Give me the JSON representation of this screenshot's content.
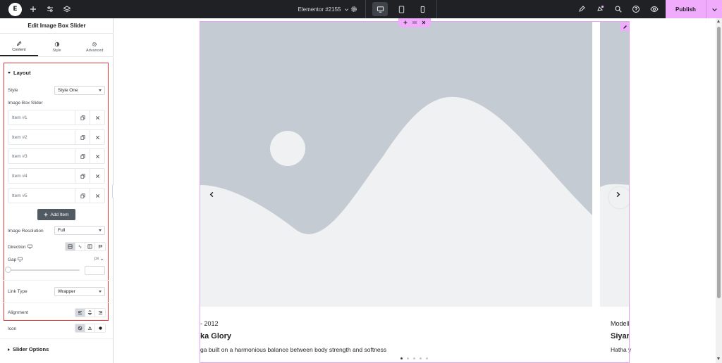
{
  "topbar": {
    "logo_letter": "E",
    "document_title": "Elementor #2155",
    "publish_label": "Publish",
    "icons": [
      "plus-icon",
      "sliders-icon",
      "layers-icon",
      "gear-icon",
      "desktop-icon",
      "tablet-icon",
      "mobile-icon",
      "notes-icon",
      "whats-new-icon",
      "search-icon",
      "help-icon",
      "preview-icon",
      "chevron-down-icon"
    ],
    "accent_color": "#f0abfc"
  },
  "panel": {
    "title": "Edit Image Box Slider",
    "tabs": [
      {
        "label": "Content",
        "icon": "pencil-icon",
        "active": true
      },
      {
        "label": "Style",
        "icon": "half-circle-icon",
        "active": false
      },
      {
        "label": "Advanced",
        "icon": "gear-icon",
        "active": false
      }
    ],
    "layout": {
      "heading": "Layout",
      "style_label": "Style",
      "style_value": "Style One",
      "repeater_label": "Image Box Slider",
      "items": [
        "Item #1",
        "Item #2",
        "Item #3",
        "Item #4",
        "Item #5"
      ],
      "add_item_label": "Add Item",
      "resolution_label": "Image Resolution",
      "resolution_value": "Full",
      "direction_label": "Direction",
      "gap_label": "Gap",
      "gap_unit": "px",
      "link_type_label": "Link Type",
      "link_type_value": "Wrapper",
      "alignment_label": "Alignment"
    },
    "icon_label": "Icon",
    "slider_options_label": "Slider Options",
    "highlight_color": "#e53535"
  },
  "canvas": {
    "slide1": {
      "date": "- 2012",
      "title": "ka Glory",
      "description": "ga built on a harmonious balance between body strength and softness"
    },
    "slide2": {
      "date": "Modell",
      "title": "Siyar",
      "description": "Hatha y"
    },
    "dots_total": 5,
    "dots_active": 1
  }
}
